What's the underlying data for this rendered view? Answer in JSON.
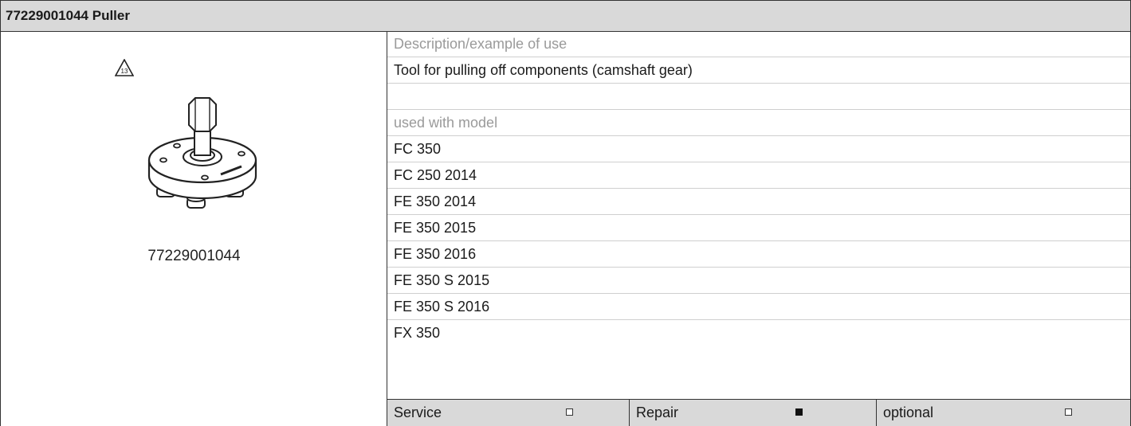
{
  "header": {
    "title": "77229001044 Puller"
  },
  "tool": {
    "warning_number": "13",
    "part_number": "77229001044"
  },
  "description": {
    "label": "Description/example of use",
    "text": "Tool for pulling off components (camshaft gear)"
  },
  "models": {
    "label": "used with model",
    "items": [
      "FC 350",
      "FC 250 2014",
      "FE 350 2014",
      "FE 350 2015",
      "FE 350 2016",
      "FE 350 S 2015",
      "FE 350 S 2016",
      "FX 350"
    ]
  },
  "footer": {
    "service_label": "Service",
    "service_checked": false,
    "repair_label": "Repair",
    "repair_checked": true,
    "optional_label": "optional",
    "optional_checked": false
  }
}
